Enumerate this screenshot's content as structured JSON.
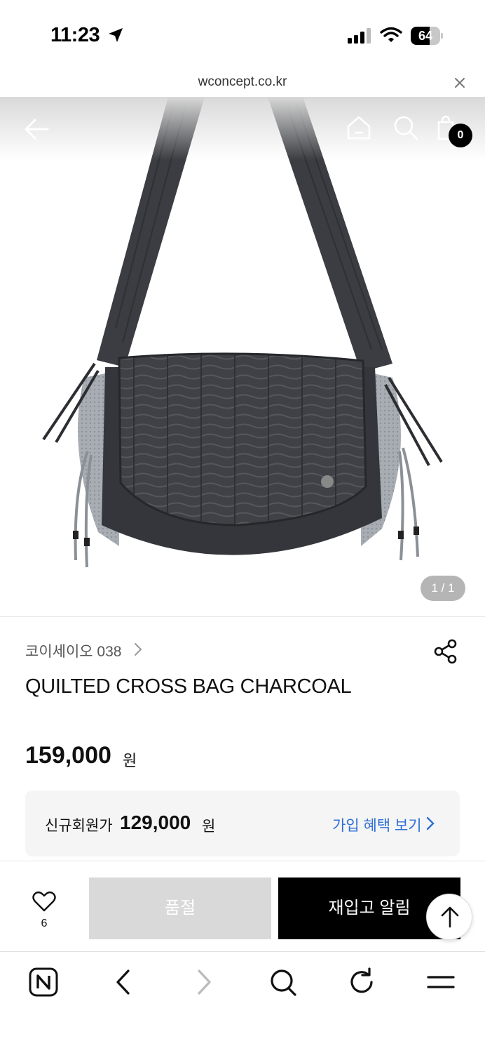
{
  "status_bar": {
    "time": "11:23",
    "battery": "64",
    "battery_level": 0.64
  },
  "browser": {
    "url": "wconcept.co.kr"
  },
  "header": {
    "cart_count": "0"
  },
  "gallery": {
    "pager": "1 / 1"
  },
  "product": {
    "brand": "코이세이오 038",
    "title": "QUILTED CROSS BAG CHARCOAL",
    "price": "159,000",
    "price_unit": "원",
    "member_label": "신규회원가",
    "member_price": "129,000",
    "member_unit": "원",
    "benefit_link": "가입 혜택 보기"
  },
  "actions": {
    "wish_count": "6",
    "soldout_label": "품절",
    "restock_label": "재입고 알림"
  },
  "icons": [
    "location-arrow-icon",
    "signal-icon",
    "wifi-icon",
    "battery-icon",
    "close-icon",
    "back-arrow-icon",
    "home-icon",
    "search-icon",
    "cart-icon",
    "chevron-right-icon",
    "share-icon",
    "heart-icon",
    "arrow-up-icon",
    "naver-icon",
    "nav-back-icon",
    "nav-forward-icon",
    "refresh-icon",
    "menu-icon"
  ]
}
